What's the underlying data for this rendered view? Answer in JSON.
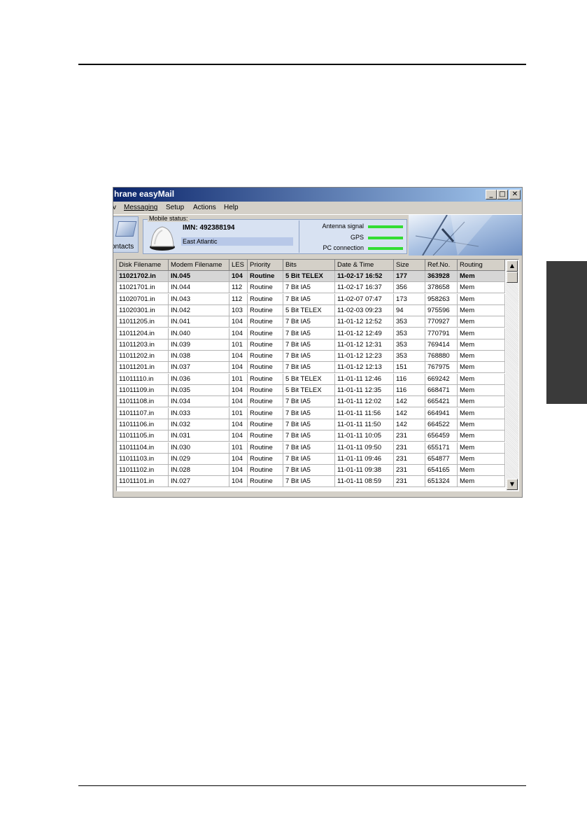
{
  "app": {
    "title": "hrane easyMail",
    "window_buttons": {
      "minimize": "_",
      "maximize": "□",
      "close": "✕"
    },
    "menu": [
      "v",
      "Messaging",
      "Setup",
      "Actions",
      "Help"
    ],
    "contacts_label": "ontacts",
    "mobile_status": {
      "legend": "Mobile status:",
      "imn": "IMN: 492388194",
      "region": "East Atlantic",
      "indicators": [
        "Antenna signal",
        "GPS",
        "PC connection"
      ],
      "indicator_color": "#33dd33"
    },
    "table": {
      "columns": [
        "Disk Filename",
        "Modem Filename",
        "LES",
        "Priority",
        "Bits",
        "Date & Time",
        "Size",
        "Ref.No.",
        "Routing"
      ],
      "rows": [
        [
          "11021702.in",
          "IN.045",
          "104",
          "Routine",
          "5 Bit TELEX",
          "11-02-17  16:52",
          "177",
          "363928",
          "Mem"
        ],
        [
          "11021701.in",
          "IN.044",
          "112",
          "Routine",
          "7 Bit IA5",
          "11-02-17  16:37",
          "356",
          "378658",
          "Mem"
        ],
        [
          "11020701.in",
          "IN.043",
          "112",
          "Routine",
          "7 Bit IA5",
          "11-02-07  07:47",
          "173",
          "958263",
          "Mem"
        ],
        [
          "11020301.in",
          "IN.042",
          "103",
          "Routine",
          "5 Bit TELEX",
          "11-02-03  09:23",
          "94",
          "975596",
          "Mem"
        ],
        [
          "11011205.in",
          "IN.041",
          "104",
          "Routine",
          "7 Bit IA5",
          "11-01-12  12:52",
          "353",
          "770927",
          "Mem"
        ],
        [
          "11011204.in",
          "IN.040",
          "104",
          "Routine",
          "7 Bit IA5",
          "11-01-12  12:49",
          "353",
          "770791",
          "Mem"
        ],
        [
          "11011203.in",
          "IN.039",
          "101",
          "Routine",
          "7 Bit IA5",
          "11-01-12  12:31",
          "353",
          "769414",
          "Mem"
        ],
        [
          "11011202.in",
          "IN.038",
          "104",
          "Routine",
          "7 Bit IA5",
          "11-01-12  12:23",
          "353",
          "768880",
          "Mem"
        ],
        [
          "11011201.in",
          "IN.037",
          "104",
          "Routine",
          "7 Bit IA5",
          "11-01-12  12:13",
          "151",
          "767975",
          "Mem"
        ],
        [
          "11011110.in",
          "IN.036",
          "101",
          "Routine",
          "5 Bit TELEX",
          "11-01-11  12:46",
          "116",
          "669242",
          "Mem"
        ],
        [
          "11011109.in",
          "IN.035",
          "104",
          "Routine",
          "5 Bit TELEX",
          "11-01-11  12:35",
          "116",
          "668471",
          "Mem"
        ],
        [
          "11011108.in",
          "IN.034",
          "104",
          "Routine",
          "7 Bit IA5",
          "11-01-11  12:02",
          "142",
          "665421",
          "Mem"
        ],
        [
          "11011107.in",
          "IN.033",
          "101",
          "Routine",
          "7 Bit IA5",
          "11-01-11  11:56",
          "142",
          "664941",
          "Mem"
        ],
        [
          "11011106.in",
          "IN.032",
          "104",
          "Routine",
          "7 Bit IA5",
          "11-01-11  11:50",
          "142",
          "664522",
          "Mem"
        ],
        [
          "11011105.in",
          "IN.031",
          "104",
          "Routine",
          "7 Bit IA5",
          "11-01-11  10:05",
          "231",
          "656459",
          "Mem"
        ],
        [
          "11011104.in",
          "IN.030",
          "101",
          "Routine",
          "7 Bit IA5",
          "11-01-11  09:50",
          "231",
          "655171",
          "Mem"
        ],
        [
          "11011103.in",
          "IN.029",
          "104",
          "Routine",
          "7 Bit IA5",
          "11-01-11  09:46",
          "231",
          "654877",
          "Mem"
        ],
        [
          "11011102.in",
          "IN.028",
          "104",
          "Routine",
          "7 Bit IA5",
          "11-01-11  09:38",
          "231",
          "654165",
          "Mem"
        ],
        [
          "11011101.in",
          "IN.027",
          "104",
          "Routine",
          "7 Bit IA5",
          "11-01-11  08:59",
          "231",
          "651324",
          "Mem"
        ]
      ]
    },
    "scroll": {
      "up": "▲",
      "down": "▼"
    }
  }
}
